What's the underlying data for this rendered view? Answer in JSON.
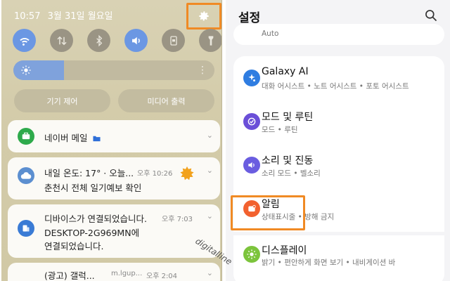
{
  "notification_shade": {
    "time": "10:57",
    "date": "3월 31일 월요일",
    "brightness_level": 0.25,
    "buttons": {
      "device_control": "기기 제어",
      "media_output": "미디어 출력"
    },
    "notifications": [
      {
        "title": "네이버 메일",
        "icon": "mail-app-icon"
      },
      {
        "title": "내일 온도: 17° · 오늘...",
        "time": "오후 10:26",
        "body": "춘천시 전체 일기예보 확인",
        "icon": "weather-icon"
      },
      {
        "title": "디바이스가 연결되었습니다.",
        "time": "오후 7:03",
        "body_line1": "DESKTOP-2G969MN에",
        "body_line2": "연결되었습니다.",
        "icon": "device-icon"
      },
      {
        "title": "(광고) 갤럭...",
        "source": "m.lgup...",
        "time": "오후 2:04"
      }
    ]
  },
  "settings": {
    "title": "설정",
    "top_partial_text": "Auto",
    "items": [
      {
        "title": "Galaxy AI",
        "subtitle": "대화 어시스트 • 노트 어시스트 • 포토 어시스트",
        "icon": "galaxy-ai-icon",
        "color": "#2f7de1"
      },
      {
        "title": "모드 및 루틴",
        "subtitle": "모드 • 루틴",
        "icon": "mode-routine-icon",
        "color": "#6b4fd8"
      },
      {
        "title": "소리 및 진동",
        "subtitle": "소리 모드 • 벨소리",
        "icon": "volume-icon",
        "color": "#6a5de0"
      },
      {
        "title": "알림",
        "subtitle": "상태표시줄 • 방해 금지",
        "icon": "notification-icon",
        "color": "#f2612f"
      },
      {
        "title": "디스플레이",
        "subtitle": "밝기 • 편안하게 화면 보기 • 내비게이션 바",
        "icon": "display-icon",
        "color": "#7cc43c"
      }
    ]
  },
  "watermark": "digitalline",
  "colors": {
    "highlight": "#f08a24",
    "quick_toggle_on": "#6b97e3"
  }
}
